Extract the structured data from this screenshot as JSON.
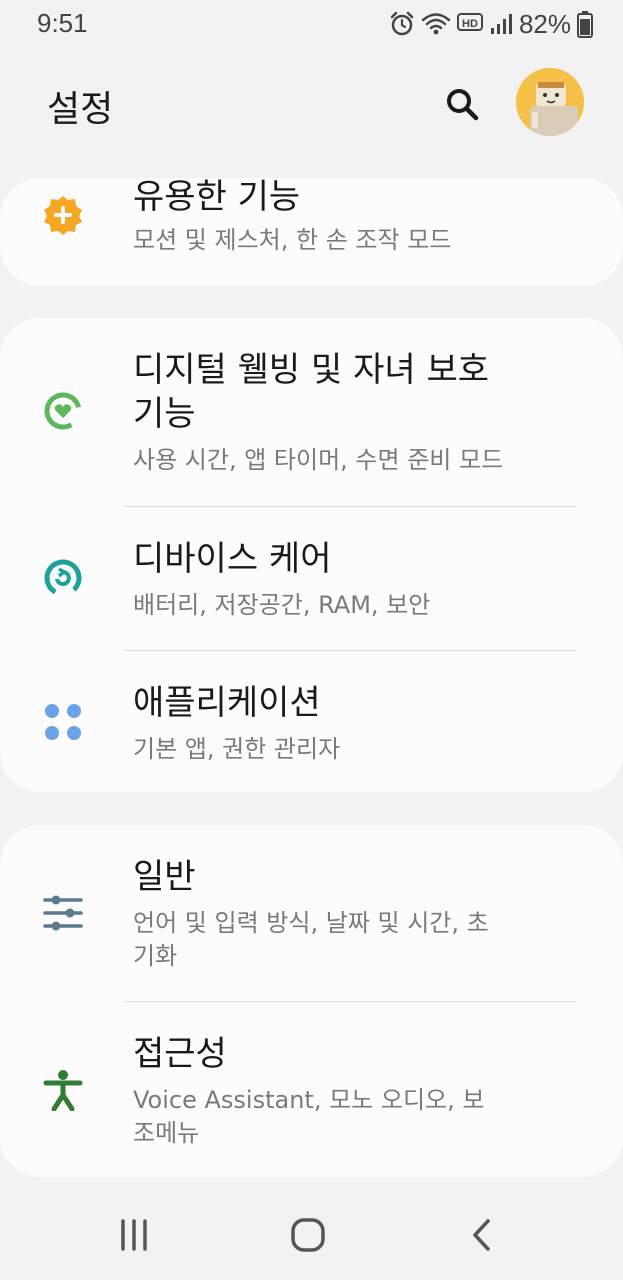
{
  "status_bar": {
    "time": "9:51",
    "battery_percent": "82%",
    "icons": [
      "alarm-icon",
      "wifi-icon",
      "hd-icon",
      "signal-icon",
      "battery-icon"
    ]
  },
  "header": {
    "title": "설정",
    "search_icon": "search-icon",
    "avatar_icon": "avatar"
  },
  "sections": [
    {
      "items": [
        {
          "title": "유용한 기능",
          "subtitle": "모션 및 제스처, 한 손 조작 모드",
          "icon": "gear-plus-icon",
          "icon_color": "#f5a623"
        }
      ]
    },
    {
      "items": [
        {
          "title": "디지털 웰빙 및 자녀 보호 기능",
          "subtitle": "사용 시간, 앱 타이머, 수면 준비 모드",
          "icon": "digital-wellbeing-icon",
          "icon_color": "#5cb85c"
        },
        {
          "title": "디바이스 케어",
          "subtitle": "배터리, 저장공간, RAM, 보안",
          "icon": "device-care-icon",
          "icon_color": "#1aa39a"
        },
        {
          "title": "애플리케이션",
          "subtitle": "기본 앱, 권한 관리자",
          "icon": "apps-icon",
          "icon_color": "#6aa3e8"
        }
      ]
    },
    {
      "items": [
        {
          "title": "일반",
          "subtitle": "언어 및 입력 방식, 날짜 및 시간, 초기화",
          "icon": "sliders-icon",
          "icon_color": "#5a7a92"
        },
        {
          "title": "접근성",
          "subtitle": "Voice Assistant, 모노 오디오, 보조메뉴",
          "icon": "accessibility-icon",
          "icon_color": "#2e7d32"
        }
      ]
    }
  ],
  "nav_bar": {
    "icons": [
      "recent-apps-icon",
      "home-icon",
      "back-icon"
    ]
  }
}
